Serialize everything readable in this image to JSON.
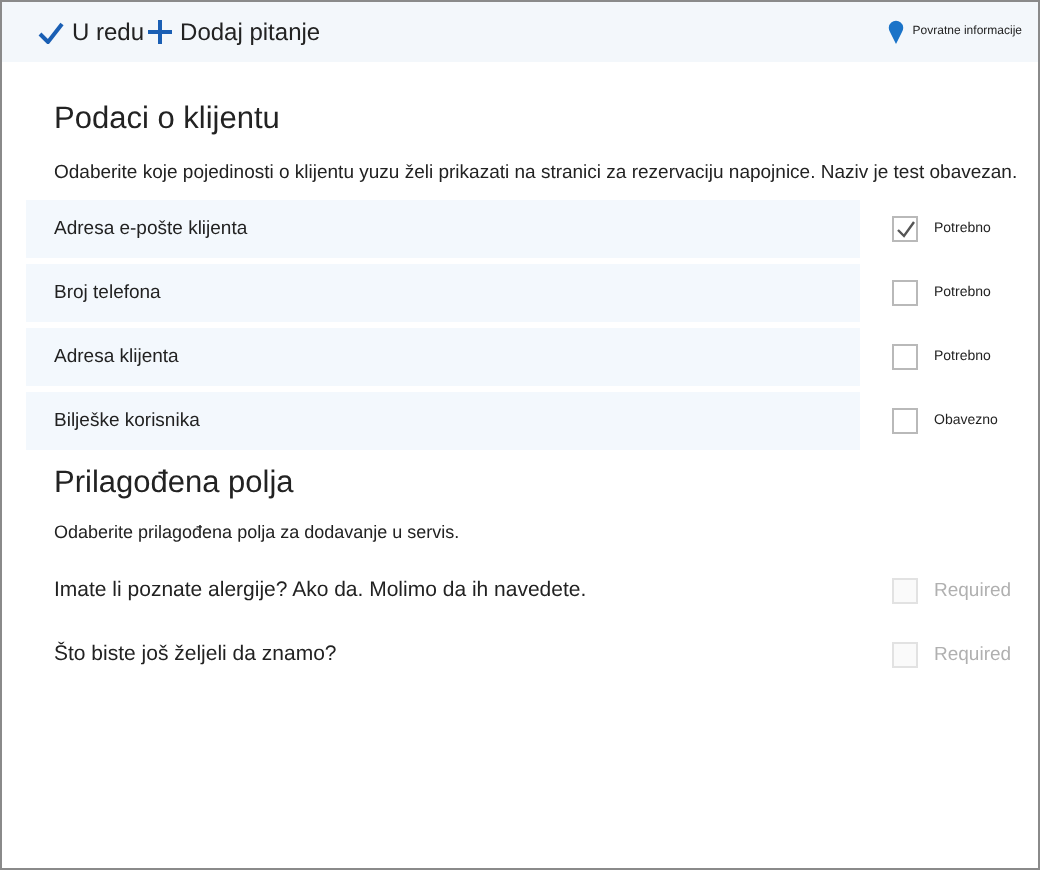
{
  "toolbar": {
    "actions": [
      {
        "kind": "ok",
        "label": "U redu"
      },
      {
        "kind": "add",
        "label": "Dodaj pitanje"
      }
    ],
    "feedback": "Povratne informacije"
  },
  "client_section": {
    "title": "Podaci o klijentu",
    "description": "Odaberite koje pojedinosti o klijentu yuzu želi prikazati na stranici za rezervaciju napojnice. Naziv je test obavezan.",
    "fields": [
      {
        "label": "Adresa e-pošte klijenta",
        "checked": true,
        "option": "Potrebno"
      },
      {
        "label": "Broj telefona",
        "checked": false,
        "option": "Potrebno"
      },
      {
        "label": "Adresa klijenta",
        "checked": false,
        "option": "Potrebno"
      },
      {
        "label": "Bilješke korisnika",
        "checked": false,
        "option": "Obavezno"
      }
    ]
  },
  "custom_section": {
    "title": "Prilagođena polja",
    "description": "Odaberite prilagođena polja za dodavanje u servis.",
    "fields": [
      {
        "label": "Imate li poznate alergije? Ako da. Molimo da ih navedete.",
        "checked": false,
        "disabled": true,
        "option": "Required"
      },
      {
        "label": "Što biste još željeli da znamo?",
        "checked": false,
        "disabled": true,
        "option": "Required"
      }
    ]
  }
}
